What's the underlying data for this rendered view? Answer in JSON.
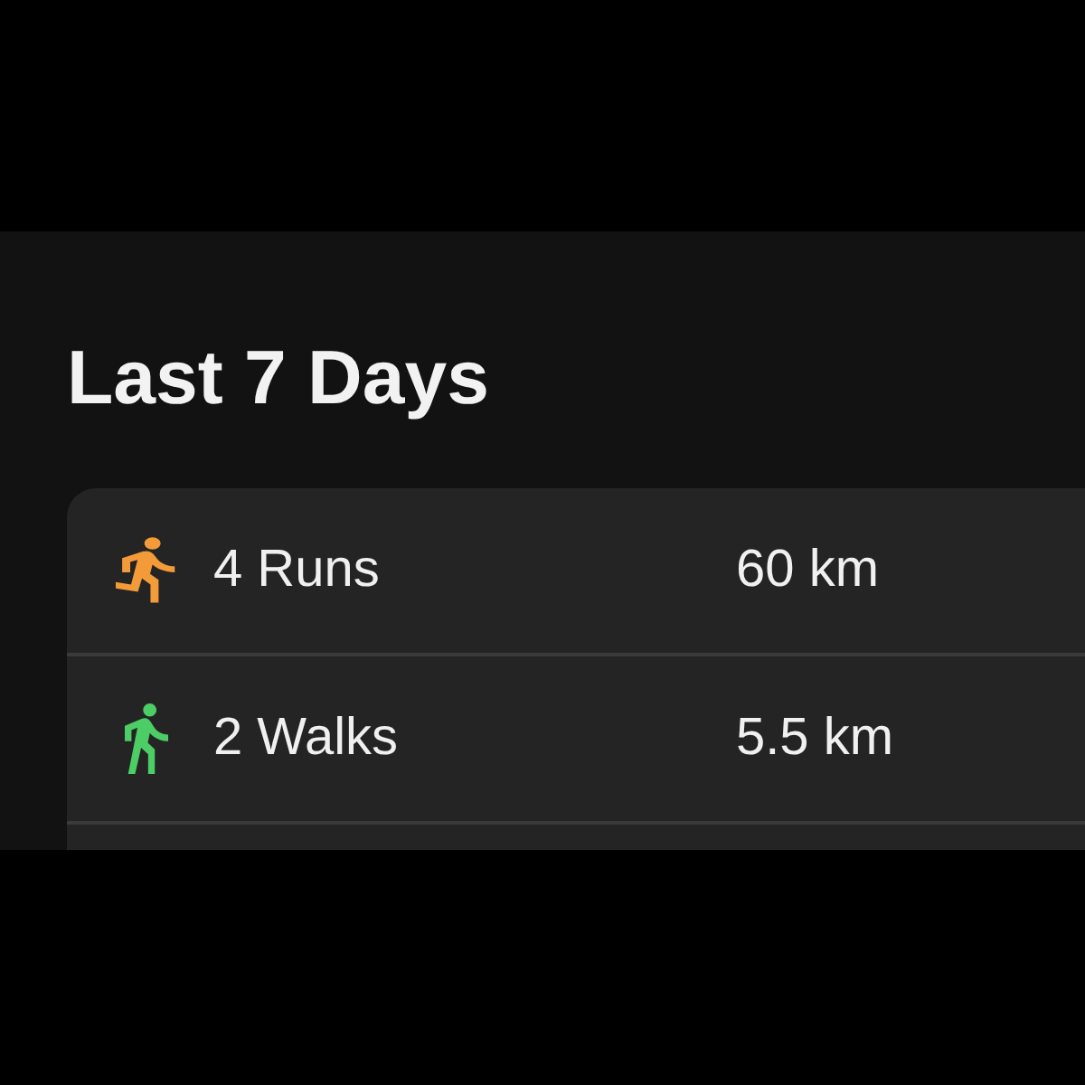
{
  "header": {
    "title": "Last 7 Days"
  },
  "activities": [
    {
      "kind": "run",
      "color": "#f29b38",
      "label": "4 Runs",
      "distance": "60 km"
    },
    {
      "kind": "walk",
      "color": "#4ccd65",
      "label": "2 Walks",
      "distance": "5.5 km"
    }
  ]
}
